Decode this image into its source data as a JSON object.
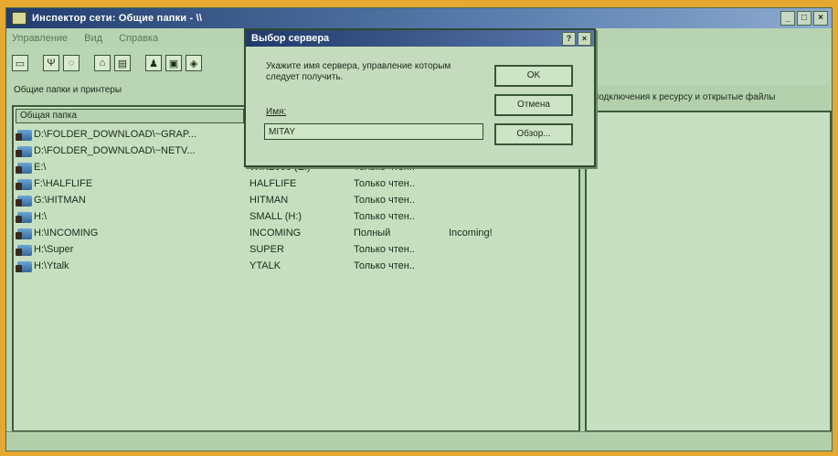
{
  "window": {
    "title": "Инспектор сети: Общие папки - \\\\",
    "controls": [
      "_",
      "□",
      "×"
    ]
  },
  "menubar": {
    "items": [
      "Управление",
      "Вид",
      "Справка"
    ]
  },
  "toolbar": {
    "buttons": [
      {
        "icon": "computer-icon"
      },
      {
        "icon": "tree-icon"
      },
      {
        "icon": "disabled-icon"
      },
      {
        "icon": "share-folder-icon"
      },
      {
        "icon": "folder-icon"
      },
      {
        "icon": "users-icon"
      },
      {
        "icon": "open-files-icon"
      },
      {
        "icon": "properties-icon"
      }
    ]
  },
  "left": {
    "section_label": "Общие папки и принтеры",
    "column_header": "Общая папка",
    "rows": [
      {
        "path": "D:\\FOLDER_DOWNLOAD\\~GRAP...",
        "resource": "",
        "access": "",
        "note": ""
      },
      {
        "path": "D:\\FOLDER_DOWNLOAD\\~NETV...",
        "resource": "",
        "access": "",
        "note": ""
      },
      {
        "path": "E:\\",
        "resource": "WIN2000 (E:)",
        "access": "Только чтен..",
        "note": ""
      },
      {
        "path": "F:\\HALFLIFE",
        "resource": "HALFLIFE",
        "access": "Только чтен..",
        "note": ""
      },
      {
        "path": "G:\\HITMAN",
        "resource": "HITMAN",
        "access": "Только чтен..",
        "note": ""
      },
      {
        "path": "H:\\",
        "resource": "SMALL (H:)",
        "access": "Только чтен..",
        "note": ""
      },
      {
        "path": "H:\\INCOMING",
        "resource": "INCOMING",
        "access": "Полный",
        "note": "Incoming!"
      },
      {
        "path": "H:\\Super",
        "resource": "SUPER",
        "access": "Только чтен..",
        "note": ""
      },
      {
        "path": "H:\\Ytalk",
        "resource": "YTALK",
        "access": "Только чтен..",
        "note": ""
      }
    ]
  },
  "right": {
    "header": "Подключения к ресурсу и открытые файлы"
  },
  "dialog": {
    "title": "Выбор сервера",
    "help_btn": "?",
    "close_btn": "×",
    "description": "Укажите имя сервера, управление которым следует получить.",
    "name_label": "Имя:",
    "name_value": "MITAY",
    "ok_label": "OK",
    "cancel_label": "Отмена",
    "browse_label": "Обзор..."
  },
  "colors": {
    "outer_frame": "#e5a830",
    "window_bg": "#b9d5b3",
    "titlebar": "#223d6e"
  }
}
